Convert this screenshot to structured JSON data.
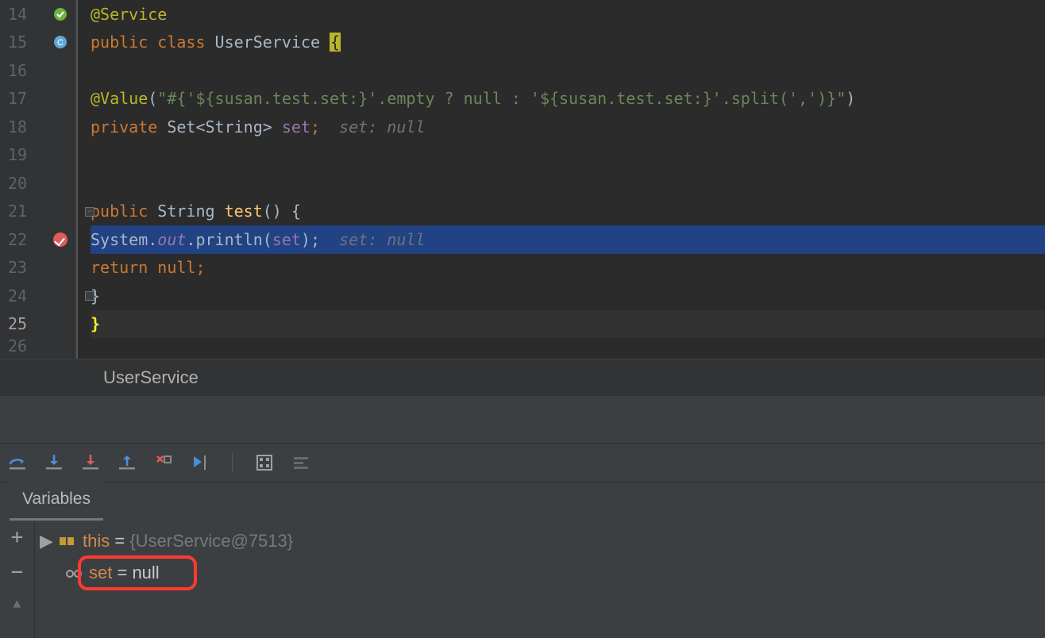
{
  "gutter": {
    "lines": [
      "14",
      "15",
      "16",
      "17",
      "18",
      "19",
      "20",
      "21",
      "22",
      "23",
      "24",
      "25",
      "26"
    ],
    "current": "25"
  },
  "code": {
    "l14_ann": "@Service",
    "l15_kw1": "public ",
    "l15_kw2": "class ",
    "l15_cls": "UserService ",
    "l15_brace": "{",
    "l17_ann": "@Value",
    "l17_p1": "(",
    "l17_str1": "\"#{'${susan.test.set:}'.empty ? null : '${susan.test.set:}'.split(',')}\"",
    "l17_p2": ")",
    "l18_kw": "private ",
    "l18_type": "Set<String> ",
    "l18_fld": "set",
    "l18_sc": ";",
    "l18_inl": "  set: null",
    "l21_kw": "public ",
    "l21_type": "String ",
    "l21_mth": "test",
    "l21_rest": "() {",
    "l22_sys": "System.",
    "l22_out": "out",
    "l22_print": ".println(",
    "l22_arg": "set",
    "l22_close": ");",
    "l22_inl": "  set: null",
    "l23_kw": "return ",
    "l23_null": "null",
    "l23_sc": ";",
    "l24_brace": "}",
    "l25_brace": "}"
  },
  "breadcrumb": "UserService",
  "variables_tab": "Variables",
  "vars": {
    "this_name": "this",
    "this_eq": " = ",
    "this_val": "{UserService@7513}",
    "set_name": "set",
    "set_eq": " = ",
    "set_val": "null"
  }
}
